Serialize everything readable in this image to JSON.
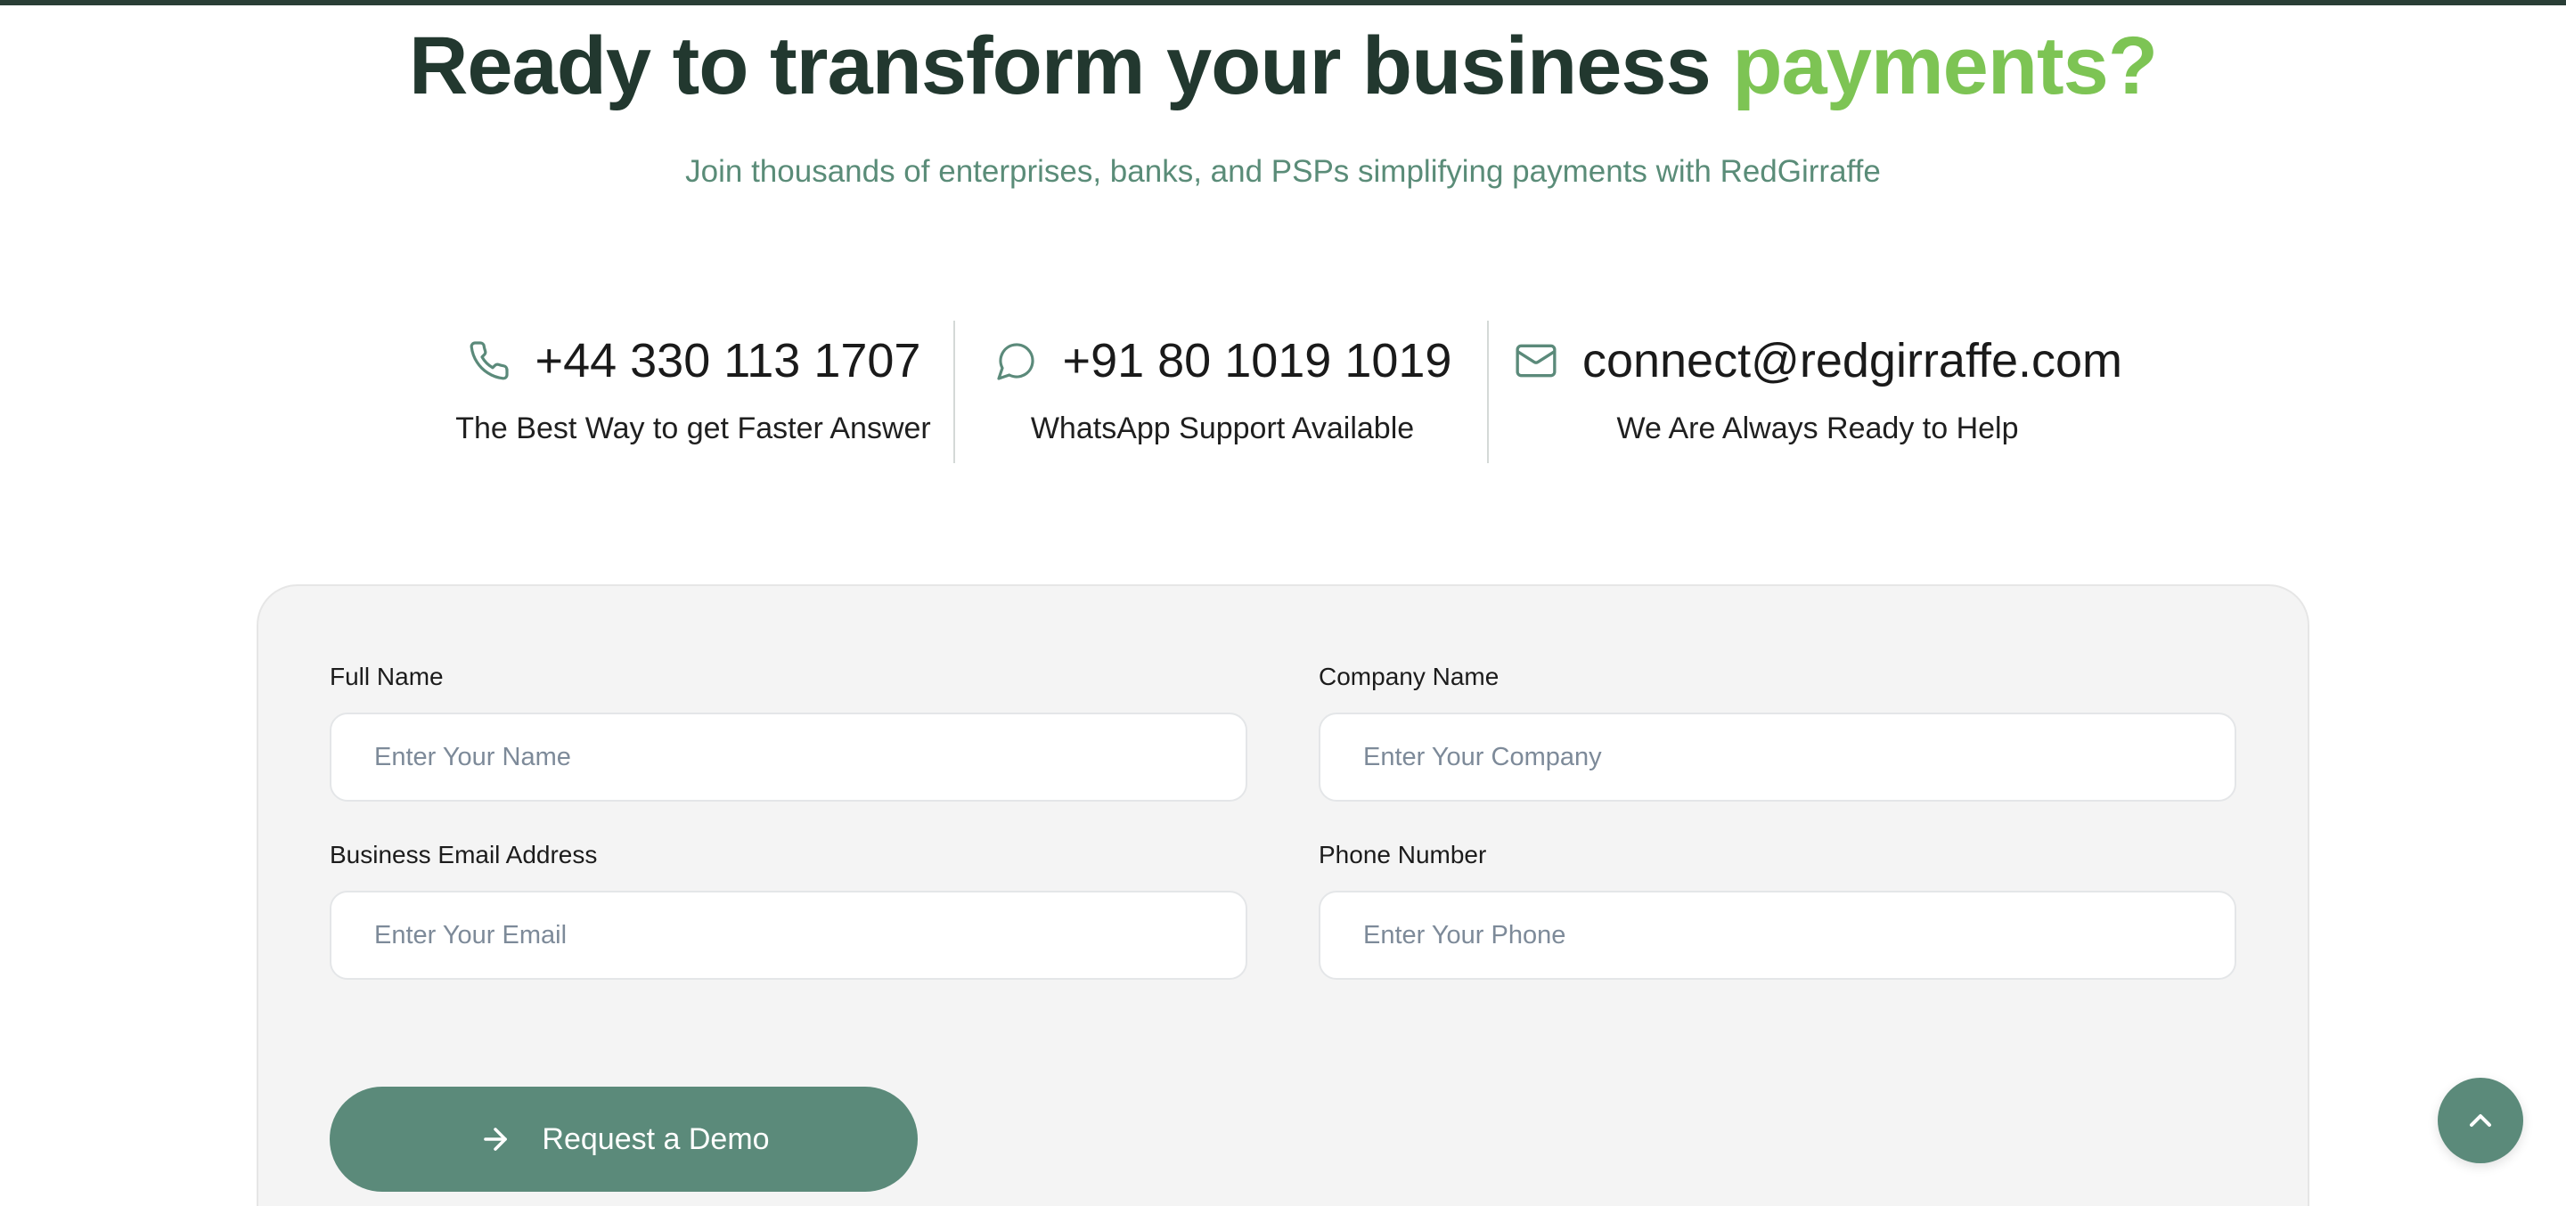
{
  "hero": {
    "headline_main": "Ready to transform your business",
    "headline_accent": "payments?",
    "subheadline": "Join thousands of enterprises, banks, and PSPs simplifying payments with RedGirraffe"
  },
  "contacts": [
    {
      "icon": "phone-icon",
      "value": "+44 330 113 1707",
      "caption": "The Best Way to get Faster Answer"
    },
    {
      "icon": "chat-bubble-icon",
      "value": "+91 80 1019 1019",
      "caption": "WhatsApp Support Available"
    },
    {
      "icon": "mail-icon",
      "value": "connect@redgirraffe.com",
      "caption": "We Are Always Ready to Help"
    }
  ],
  "form": {
    "full_name": {
      "label": "Full Name",
      "placeholder": "Enter Your Name",
      "value": ""
    },
    "company_name": {
      "label": "Company Name",
      "placeholder": "Enter Your Company",
      "value": ""
    },
    "email": {
      "label": "Business Email Address",
      "placeholder": "Enter Your Email",
      "value": ""
    },
    "phone": {
      "label": "Phone Number",
      "placeholder": "Enter Your Phone",
      "value": ""
    },
    "submit_label": "Request a Demo",
    "submit_icon": "arrow-right-icon"
  },
  "scroll_top": {
    "icon": "chevron-up-icon"
  },
  "colors": {
    "heading": "#22382f",
    "accent": "#7dc454",
    "subheading": "#5a8c78",
    "primary": "#5b8a7a",
    "card_bg": "#f4f4f4",
    "top_bar": "#2a3e36"
  }
}
